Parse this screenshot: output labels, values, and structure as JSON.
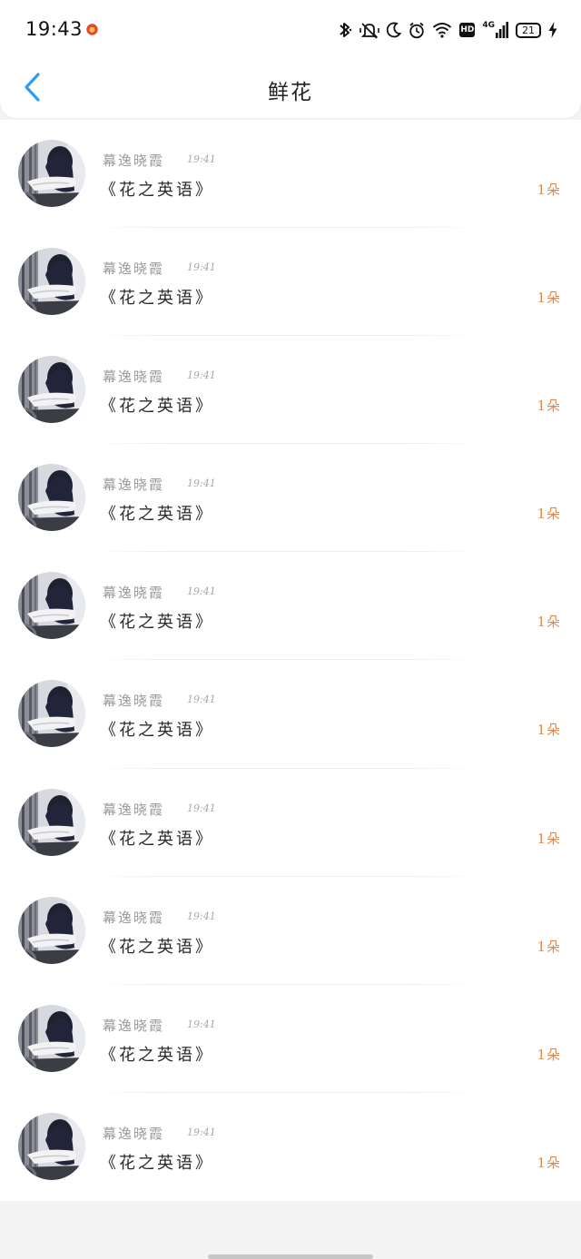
{
  "status_bar": {
    "time": "19:43",
    "network_label": "4G",
    "hd_label": "HD",
    "battery": "21",
    "icons": [
      "notification-dot-icon",
      "bluetooth-icon",
      "vibrate-mute-icon",
      "moon-icon",
      "alarm-icon",
      "wifi-icon",
      "hd-icon",
      "signal-icon",
      "battery-icon",
      "charging-icon"
    ]
  },
  "header": {
    "title": "鲜花",
    "back_icon": "back-chevron-icon",
    "accent_color": "#2f9cf2"
  },
  "gift_colors": {
    "count_color": "#e0894c"
  },
  "records": [
    {
      "sender": "幕逸晓霞",
      "time": "19:41",
      "gift": "《花之英语》",
      "count": "1朵"
    },
    {
      "sender": "幕逸晓霞",
      "time": "19:41",
      "gift": "《花之英语》",
      "count": "1朵"
    },
    {
      "sender": "幕逸晓霞",
      "time": "19:41",
      "gift": "《花之英语》",
      "count": "1朵"
    },
    {
      "sender": "幕逸晓霞",
      "time": "19:41",
      "gift": "《花之英语》",
      "count": "1朵"
    },
    {
      "sender": "幕逸晓霞",
      "time": "19:41",
      "gift": "《花之英语》",
      "count": "1朵"
    },
    {
      "sender": "幕逸晓霞",
      "time": "19:41",
      "gift": "《花之英语》",
      "count": "1朵"
    },
    {
      "sender": "幕逸晓霞",
      "time": "19:41",
      "gift": "《花之英语》",
      "count": "1朵"
    },
    {
      "sender": "幕逸晓霞",
      "time": "19:41",
      "gift": "《花之英语》",
      "count": "1朵"
    },
    {
      "sender": "幕逸晓霞",
      "time": "19:41",
      "gift": "《花之英语》",
      "count": "1朵"
    },
    {
      "sender": "幕逸晓霞",
      "time": "19:41",
      "gift": "《花之英语》",
      "count": "1朵"
    }
  ]
}
